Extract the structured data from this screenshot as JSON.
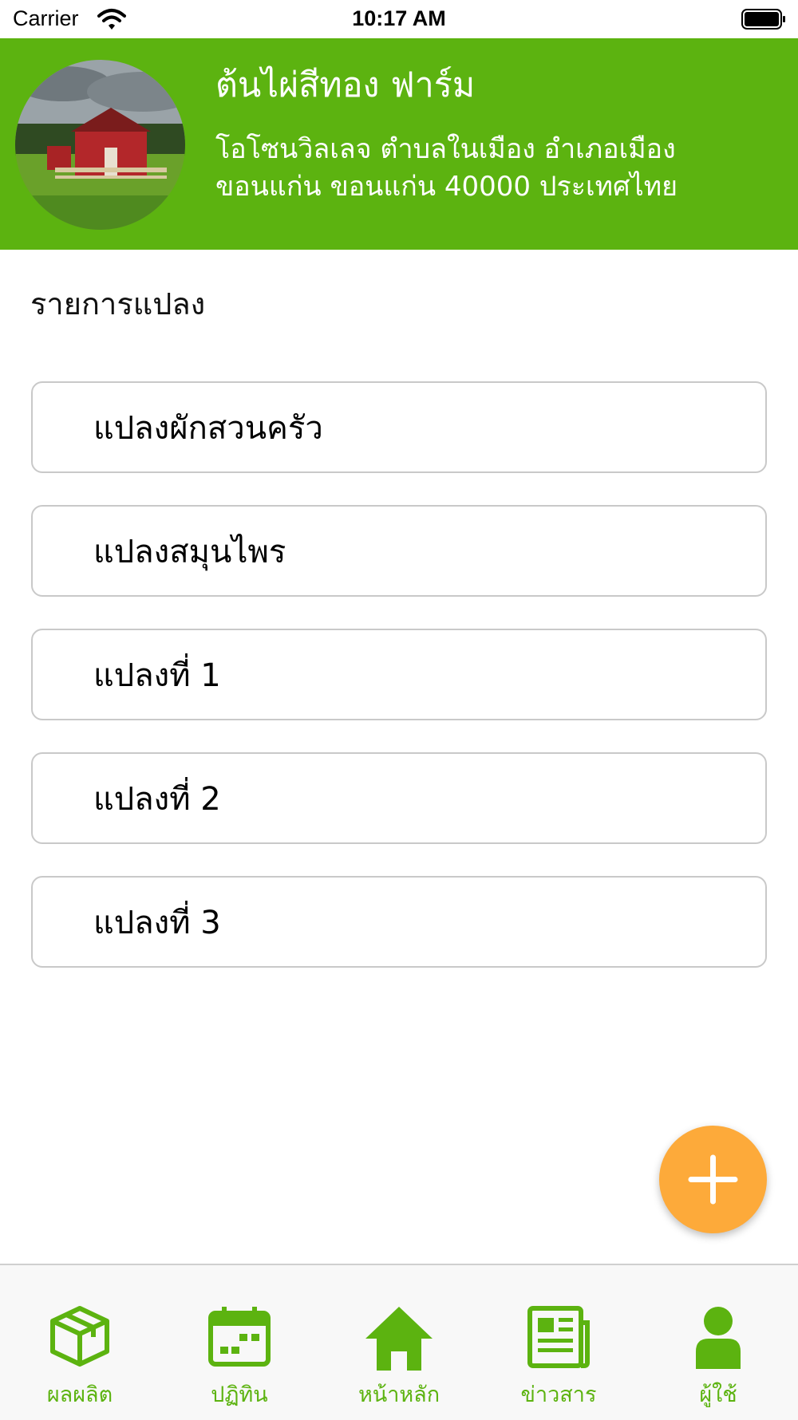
{
  "status_bar": {
    "carrier": "Carrier",
    "time": "10:17 AM"
  },
  "header": {
    "farm_name": "ต้นไผ่สีทอง ฟาร์ม",
    "address": "โอโซนวิลเลจ ตำบลในเมือง อำเภอเมืองขอนแก่น ขอนแก่น 40000 ประเทศไทย"
  },
  "section_title": "รายการแปลง",
  "plots": [
    {
      "label": "แปลงผักสวนครัว"
    },
    {
      "label": "แปลงสมุนไพร"
    },
    {
      "label": "แปลงที่ 1"
    },
    {
      "label": "แปลงที่ 2"
    },
    {
      "label": "แปลงที่ 3"
    }
  ],
  "fab": {
    "icon": "plus-icon",
    "color": "#fdaa3a"
  },
  "tabs": [
    {
      "label": "ผลผลิต",
      "icon": "box-icon"
    },
    {
      "label": "ปฏิทิน",
      "icon": "calendar-icon"
    },
    {
      "label": "หน้าหลัก",
      "icon": "home-icon"
    },
    {
      "label": "ข่าวสาร",
      "icon": "newspaper-icon"
    },
    {
      "label": "ผู้ใช้",
      "icon": "user-icon"
    }
  ],
  "colors": {
    "brand_green": "#5cb310",
    "accent_orange": "#fdaa3a"
  }
}
